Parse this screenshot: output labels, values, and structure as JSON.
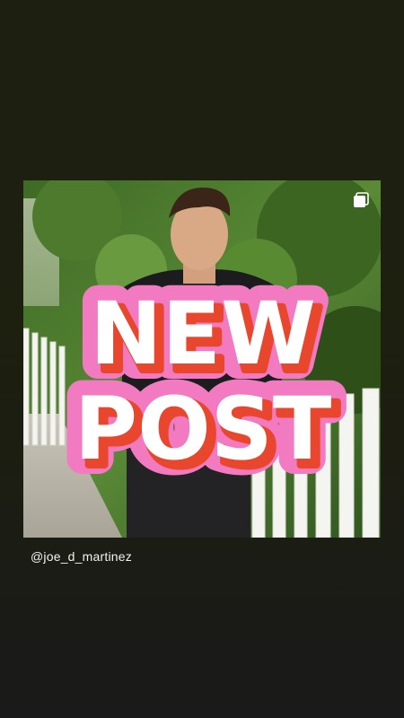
{
  "story": {
    "username": "@joe_d_martinez",
    "sticker": {
      "line1": "NEW",
      "line2": "POST"
    },
    "icons": {
      "multi_post": "square-stack-icon"
    }
  },
  "colors": {
    "background": "#1d200f",
    "sticker_pink": "#f27ac0",
    "sticker_red": "#e8472e",
    "sticker_white": "#ffffff",
    "username_text": "#f2f2f2"
  }
}
